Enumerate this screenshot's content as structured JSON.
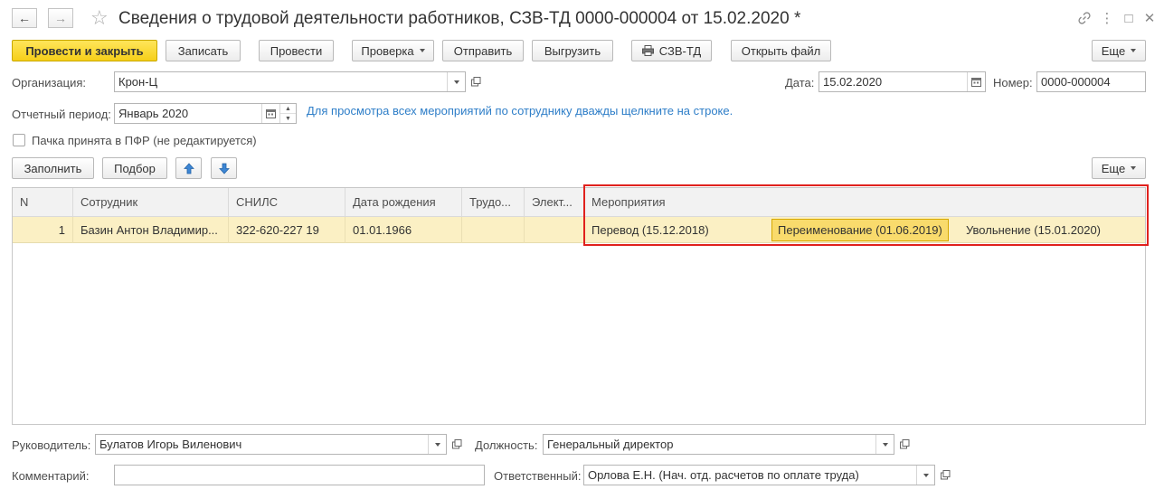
{
  "window": {
    "title": "Сведения о трудовой деятельности работников, СЗВ-ТД 0000-000004 от 15.02.2020 *",
    "back_glyph": "←",
    "forward_glyph": "→",
    "star_glyph": "☆",
    "link_glyph": "🔗",
    "menu_glyph": "⋮",
    "maximize_glyph": "□",
    "close_glyph": "✕"
  },
  "toolbar": {
    "post_close": "Провести и закрыть",
    "save": "Записать",
    "post": "Провести",
    "check": "Проверка",
    "send": "Отправить",
    "export": "Выгрузить",
    "print_szv": "СЗВ-ТД",
    "open_file": "Открыть файл",
    "more": "Еще"
  },
  "form": {
    "org_label": "Организация:",
    "org_value": "Крон-Ц",
    "date_label": "Дата:",
    "date_value": "15.02.2020",
    "number_label": "Номер:",
    "number_value": "0000-000004",
    "period_label": "Отчетный период:",
    "period_value": "Январь 2020",
    "hint": "Для просмотра всех мероприятий по сотруднику дважды щелкните на строке.",
    "accepted_label": "Пачка принята в ПФР (не редактируется)"
  },
  "table_toolbar": {
    "fill": "Заполнить",
    "select": "Подбор",
    "more": "Еще"
  },
  "table": {
    "headers": {
      "n": "N",
      "employee": "Сотрудник",
      "snils": "СНИЛС",
      "birth": "Дата рождения",
      "labor": "Трудо...",
      "electronic": "Элект...",
      "events": "Мероприятия"
    },
    "rows": [
      {
        "n": "1",
        "employee": "Базин Антон Владимир...",
        "snils": "322-620-227 19",
        "birth": "01.01.1966",
        "labor": "",
        "electronic": "",
        "events": [
          "Перевод (15.12.2018)",
          "Переименование (01.06.2019)",
          "Увольнение (15.01.2020)"
        ]
      }
    ]
  },
  "footer": {
    "head_label": "Руководитель:",
    "head_value": "Булатов Игорь Виленович",
    "position_label": "Должность:",
    "position_value": "Генеральный директор",
    "comment_label": "Комментарий:",
    "comment_value": "",
    "responsible_label": "Ответственный:",
    "responsible_value": "Орлова Е.Н. (Нач. отд. расчетов по оплате труда)"
  },
  "colors": {
    "primary_button": "#f6cf18",
    "selected_row": "#fbf0c4",
    "selected_cell": "#f9db6c",
    "highlight_frame": "#e0211d",
    "hint_text": "#2e7ec8"
  }
}
